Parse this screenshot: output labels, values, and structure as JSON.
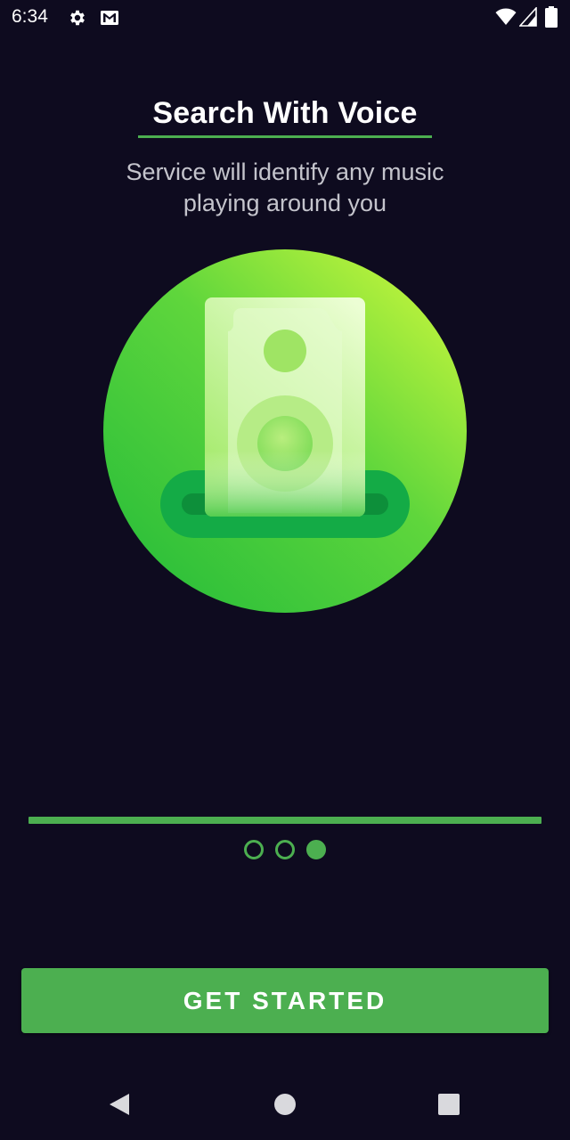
{
  "status_bar": {
    "time": "6:34",
    "left_icons": [
      "gear-icon",
      "gmail-icon"
    ],
    "right_icons": [
      "wifi-icon",
      "signal-icon",
      "battery-icon"
    ]
  },
  "onboarding": {
    "title": "Search With Voice",
    "subtitle": "Service will identify any music playing around you",
    "illustration": "speaker-icon",
    "progress_fraction": 1.0,
    "pages": {
      "count": 3,
      "current": 3
    }
  },
  "actions": {
    "get_started_label": "GET STARTED"
  },
  "nav_bar": {
    "buttons": [
      "back-icon",
      "home-icon",
      "recents-icon"
    ]
  },
  "colors": {
    "background": "#0e0b1f",
    "accent": "#4caf50",
    "text_primary": "#ffffff",
    "text_secondary": "#c4c4cc"
  }
}
